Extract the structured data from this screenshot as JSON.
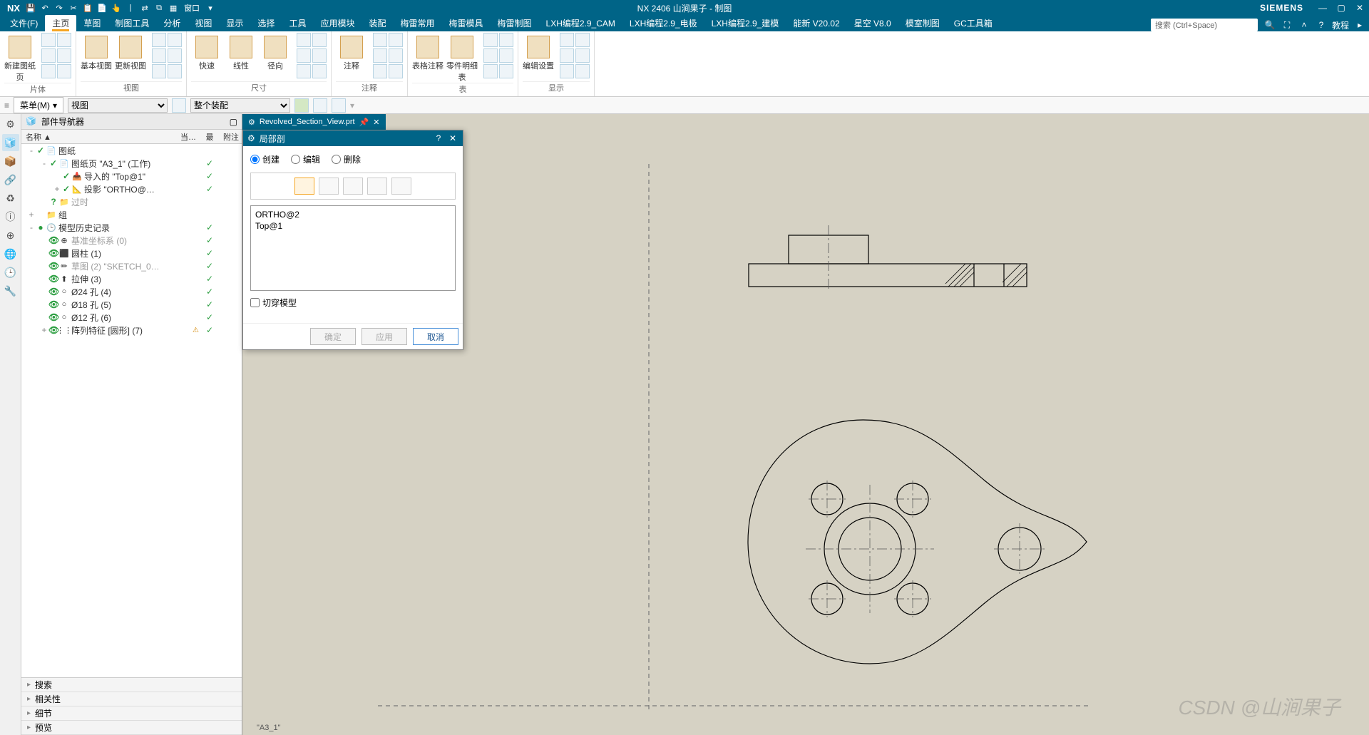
{
  "app": {
    "logo": "NX",
    "title": "NX 2406 山涧果子 - 制图",
    "brand": "SIEMENS"
  },
  "qat": {
    "window_label": "窗口"
  },
  "menu": {
    "items": [
      "文件(F)",
      "主页",
      "草图",
      "制图工具",
      "分析",
      "视图",
      "显示",
      "选择",
      "工具",
      "应用模块",
      "装配",
      "梅雷常用",
      "梅雷模具",
      "梅雷制图",
      "LXH编程2.9_CAM",
      "LXH编程2.9_电极",
      "LXH编程2.9_建模",
      "能新 V20.02",
      "星空 V8.0",
      "模室制图",
      "GC工具箱"
    ],
    "active": 1,
    "search_placeholder": "搜索 (Ctrl+Space)",
    "tutorial": "教程"
  },
  "ribbon": {
    "groups": [
      {
        "label": "片体",
        "big": [
          {
            "lbl": "新建图纸页"
          }
        ]
      },
      {
        "label": "视图",
        "big": [
          {
            "lbl": "基本视图"
          },
          {
            "lbl": "更新视图"
          }
        ]
      },
      {
        "label": "尺寸",
        "big": [
          {
            "lbl": "快速"
          },
          {
            "lbl": "线性"
          },
          {
            "lbl": "径向"
          }
        ]
      },
      {
        "label": "注释",
        "big": [
          {
            "lbl": "注释"
          }
        ]
      },
      {
        "label": "表",
        "big": [
          {
            "lbl": "表格注释"
          },
          {
            "lbl": "零件明细表"
          }
        ]
      },
      {
        "label": "显示",
        "big": [
          {
            "lbl": "编辑设置"
          }
        ]
      }
    ]
  },
  "selbar": {
    "menu": "菜单(M)",
    "combo1": "视图",
    "combo2": "整个装配"
  },
  "nav": {
    "title": "部件导航器",
    "cols": {
      "c1": "名称 ▲",
      "c2": "当…",
      "c3": "最",
      "c4": "附注"
    },
    "tree": [
      {
        "ind": 0,
        "exp": "-",
        "chk": "✓",
        "ico": "📄",
        "lbl": "图纸",
        "rc": ""
      },
      {
        "ind": 1,
        "exp": "-",
        "chk": "✓",
        "ico": "📄",
        "lbl": "图纸页 \"A3_1\" (工作)",
        "rc": "✓"
      },
      {
        "ind": 2,
        "exp": "",
        "chk": "✓",
        "ico": "📥",
        "lbl": "导入的 \"Top@1\"",
        "rc": "✓"
      },
      {
        "ind": 2,
        "exp": "+",
        "chk": "✓",
        "ico": "📐",
        "lbl": "投影 \"ORTHO@…",
        "rc": "✓"
      },
      {
        "ind": 1,
        "exp": "",
        "chk": "?",
        "ico": "📁",
        "lbl": "过时",
        "rc": "",
        "dim": true
      },
      {
        "ind": 0,
        "exp": "+",
        "chk": "",
        "ico": "📁",
        "lbl": "组",
        "rc": ""
      },
      {
        "ind": 0,
        "exp": "-",
        "chk": "●",
        "ico": "🕒",
        "lbl": "模型历史记录",
        "rc": "✓"
      },
      {
        "ind": 1,
        "exp": "",
        "chk": "👁",
        "ico": "⊕",
        "lbl": "基准坐标系 (0)",
        "rc": "✓",
        "dim": true
      },
      {
        "ind": 1,
        "exp": "",
        "chk": "👁",
        "ico": "⬛",
        "lbl": "圆柱 (1)",
        "rc": "✓"
      },
      {
        "ind": 1,
        "exp": "",
        "chk": "👁",
        "ico": "✏",
        "lbl": "草图 (2) \"SKETCH_0…",
        "rc": "✓",
        "dim": true
      },
      {
        "ind": 1,
        "exp": "",
        "chk": "👁",
        "ico": "⬆",
        "lbl": "拉伸 (3)",
        "rc": "✓"
      },
      {
        "ind": 1,
        "exp": "",
        "chk": "👁",
        "ico": "○",
        "lbl": "Ø24 孔 (4)",
        "rc": "✓"
      },
      {
        "ind": 1,
        "exp": "",
        "chk": "👁",
        "ico": "○",
        "lbl": "Ø18 孔 (5)",
        "rc": "✓"
      },
      {
        "ind": 1,
        "exp": "",
        "chk": "👁",
        "ico": "○",
        "lbl": "Ø12 孔 (6)",
        "rc": "✓"
      },
      {
        "ind": 1,
        "exp": "+",
        "chk": "👁",
        "ico": "⋮⋮",
        "lbl": "阵列特征 [圆形] (7)",
        "rc": "✓",
        "warn": true
      }
    ],
    "accordion": [
      "搜索",
      "相关性",
      "细节",
      "预览"
    ]
  },
  "doctab": {
    "name": "Revolved_Section_View.prt"
  },
  "dialog": {
    "title": "局部剖",
    "radios": [
      {
        "lbl": "创建",
        "sel": true
      },
      {
        "lbl": "编辑",
        "sel": false
      },
      {
        "lbl": "删除",
        "sel": false
      }
    ],
    "list": [
      "ORTHO@2",
      "Top@1"
    ],
    "chk": "切穿模型",
    "btns": {
      "ok": "确定",
      "apply": "应用",
      "cancel": "取消"
    }
  },
  "sheet": {
    "label": "\"A3_1\""
  },
  "watermark": "CSDN @山涧果子"
}
